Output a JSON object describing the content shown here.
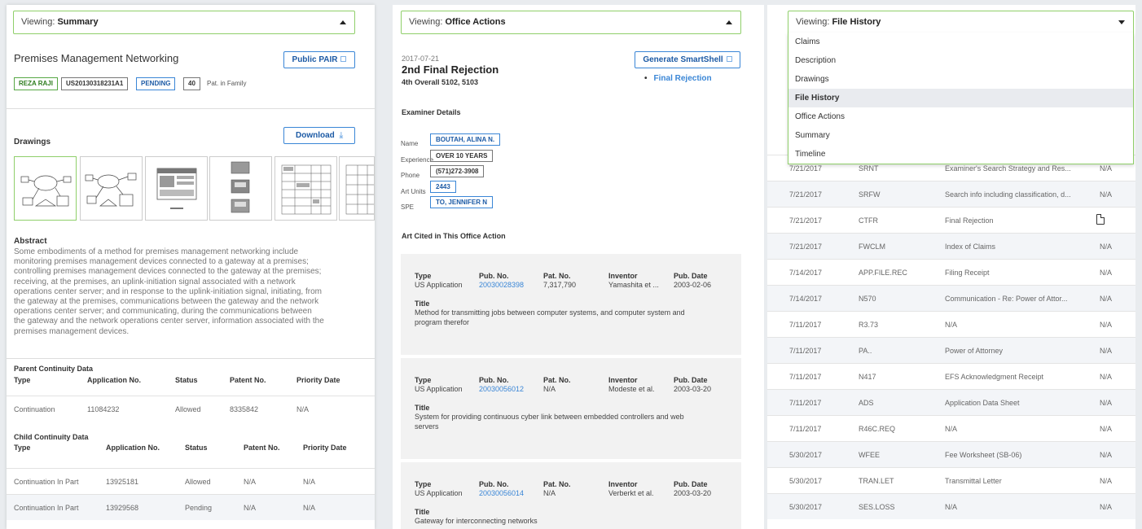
{
  "summary_pane": {
    "viewing_prefix": "Viewing: ",
    "viewing_value": "Summary",
    "title": "Premises Management Networking",
    "public_pair_label": "Public PAIR",
    "tags": [
      "REZA RAJI",
      "US20130318231A1",
      "PENDING",
      "40"
    ],
    "family_label": "Pat. in Family",
    "drawings_heading": "Drawings",
    "download_label": "Download",
    "abstract_heading": "Abstract",
    "abstract_lines": [
      "Some embodiments of a method for premises management networking include",
      "monitoring premises management devices connected to a gateway at a premises;",
      "controlling premises management devices connected to the gateway at the premises;",
      "receiving, at the premises, an uplink-initiation signal associated with a network",
      "operations center server; and in response to the uplink-initiation signal, initiating, from",
      "the gateway at the premises, communications between the gateway and the network",
      "operations center server; and communicating, during the communications between",
      "the gateway and the network operations center server, information associated with the",
      "premises management devices."
    ],
    "parent_heading": "Parent Continuity Data",
    "parent_headers": [
      "Type",
      "Application No.",
      "Status",
      "Patent No.",
      "Priority Date"
    ],
    "parent_rows": [
      [
        "Continuation",
        "11084232",
        "Allowed",
        "8335842",
        "N/A"
      ]
    ],
    "child_heading": "Child Continuity Data",
    "child_headers": [
      "Type",
      "Application No.",
      "Status",
      "Patent No.",
      "Priority Date"
    ],
    "child_rows": [
      [
        "Continuation In Part",
        "13925181",
        "Allowed",
        "N/A",
        "N/A"
      ],
      [
        "Continuation In Part",
        "13929568",
        "Pending",
        "N/A",
        "N/A"
      ]
    ]
  },
  "office_pane": {
    "viewing_prefix": "Viewing: ",
    "viewing_value": "Office Actions",
    "date": "2017-07-21",
    "title": "2nd Final Rejection",
    "subtitle": "4th Overall 5102, 5103",
    "smartshell_label": "Generate SmartShell",
    "bullet_link": "Final Rejection",
    "examiner_heading": "Examiner Details",
    "examiner": [
      {
        "label": "Name",
        "value": "BOUTAH, ALINA N."
      },
      {
        "label": "Experience",
        "value": "OVER 10 YEARS"
      },
      {
        "label": "Phone",
        "value": "(571)272-3908"
      },
      {
        "label": "Art Units",
        "value": "2443"
      },
      {
        "label": "SPE",
        "value": "TO, JENNIFER N"
      }
    ],
    "art_heading": "Art Cited in This Office Action",
    "col_headers": {
      "type": "Type",
      "pub": "Pub. No.",
      "pat": "Pat. No.",
      "inventor": "Inventor",
      "date": "Pub. Date",
      "title": "Title"
    },
    "cited": [
      {
        "type": "US Application",
        "pub": "20030028398",
        "pat": "7,317,790",
        "inventor": "Yamashita et ...",
        "date": "2003-02-06",
        "title_lines": [
          "Method for transmitting jobs between computer systems, and computer system and",
          "program therefor"
        ]
      },
      {
        "type": "US Application",
        "pub": "20030056012",
        "pat": "N/A",
        "inventor": "Modeste et al.",
        "date": "2003-03-20",
        "title_lines": [
          "System for providing continuous cyber link between embedded controllers and web",
          "servers"
        ]
      },
      {
        "type": "US Application",
        "pub": "20030056014",
        "pat": "N/A",
        "inventor": "Verberkt et al.",
        "date": "2003-03-20",
        "title_lines": [
          "Gateway for interconnecting networks"
        ]
      }
    ]
  },
  "history_pane": {
    "viewing_prefix": "Viewing: ",
    "viewing_value": "File History",
    "dropdown_options": [
      "Claims",
      "Description",
      "Drawings",
      "File History",
      "Office Actions",
      "Summary",
      "Timeline"
    ],
    "dropdown_selected": "File History",
    "rows": [
      [
        "7/21/2017",
        "SRNT",
        "Examiner's Search Strategy and Res...",
        "N/A"
      ],
      [
        "7/21/2017",
        "SRFW",
        "Search info including classification, d...",
        "N/A"
      ],
      [
        "7/21/2017",
        "CTFR",
        "Final Rejection",
        ""
      ],
      [
        "7/21/2017",
        "FWCLM",
        "Index of Claims",
        "N/A"
      ],
      [
        "7/14/2017",
        "APP.FILE.REC",
        "Filing Receipt",
        "N/A"
      ],
      [
        "7/14/2017",
        "N570",
        "Communication - Re: Power of Attor...",
        "N/A"
      ],
      [
        "7/11/2017",
        "R3.73",
        "N/A",
        "N/A"
      ],
      [
        "7/11/2017",
        "PA..",
        "Power of Attorney",
        "N/A"
      ],
      [
        "7/11/2017",
        "N417",
        "EFS Acknowledgment Receipt",
        "N/A"
      ],
      [
        "7/11/2017",
        "ADS",
        "Application Data Sheet",
        "N/A"
      ],
      [
        "7/11/2017",
        "R46C.REQ",
        "N/A",
        "N/A"
      ],
      [
        "5/30/2017",
        "WFEE",
        "Fee Worksheet (SB-06)",
        "N/A"
      ],
      [
        "5/30/2017",
        "TRAN.LET",
        "Transmittal Letter",
        "N/A"
      ],
      [
        "5/30/2017",
        "SES.LOSS",
        "N/A",
        "N/A"
      ]
    ]
  }
}
